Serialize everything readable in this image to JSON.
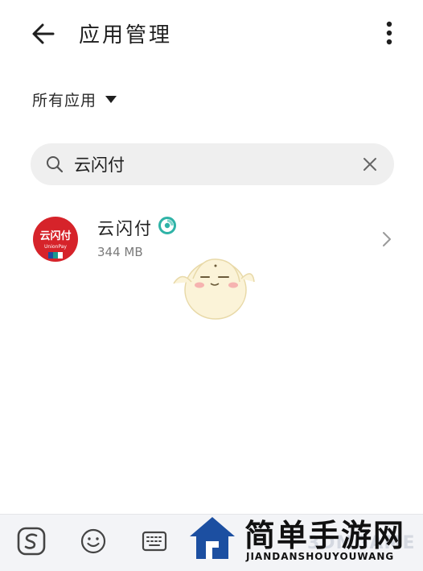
{
  "header": {
    "title": "应用管理"
  },
  "filter": {
    "label": "所有应用"
  },
  "search": {
    "value": "云闪付"
  },
  "app": {
    "name": "云闪付",
    "size": "344 MB",
    "icon_text": "云闪付",
    "icon_subtext": "UnionPay"
  },
  "watermark": {
    "title": "简单手游网",
    "subtitle": "JIANDANSHOUYOUWANG",
    "faint": "3DMGAME"
  },
  "icons": {
    "back": "arrow-left-icon",
    "more": "more-vertical-icon",
    "caret": "caret-down-icon",
    "search": "search-icon",
    "clear": "close-icon",
    "chevron": "chevron-right-icon",
    "badge": "verified-shield-icon"
  },
  "colors": {
    "app_icon_red": "#d6232a",
    "search_bg": "#efefef",
    "badge_teal": "#2fb3a7",
    "watermark_blue": "#1c4fa1"
  }
}
